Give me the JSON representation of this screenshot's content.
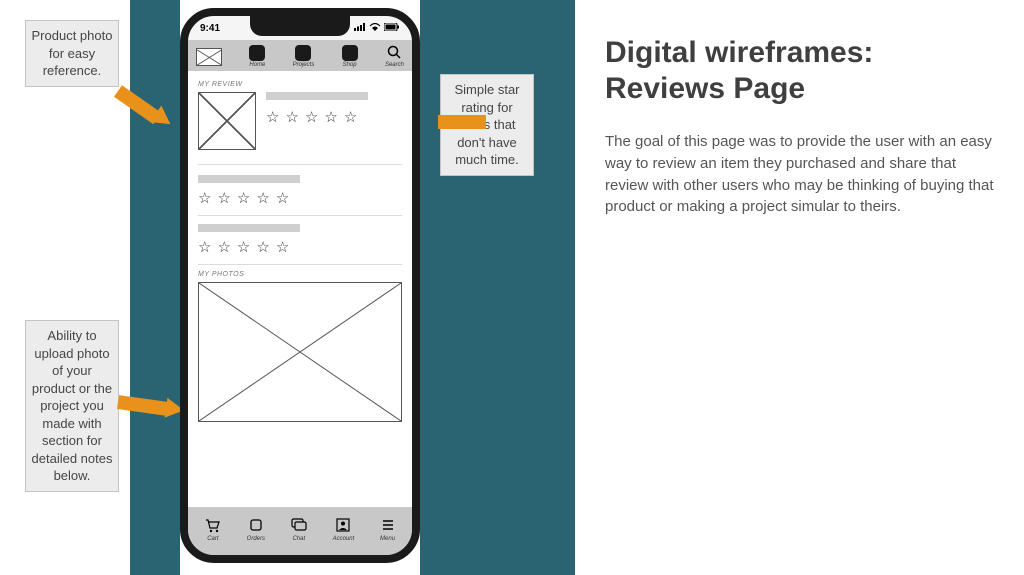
{
  "slide": {
    "heading": "Digital wireframes: Reviews Page",
    "paragraph": "The goal of this page was to provide the user with an easy way to review an item they purchased and share that review with other users who may be thinking of buying that product or making a project simular to theirs."
  },
  "callouts": {
    "product_photo": "Product photo for easy reference.",
    "star_rating": "Simple star rating for users that don't have much time.",
    "upload_photo": "Ability to upload photo of your product or the project you made with section for detailed notes below."
  },
  "phone": {
    "status": {
      "time": "9:41"
    },
    "topnav": {
      "home": "Home",
      "projects": "Projects",
      "shop": "Shop",
      "search": "Search"
    },
    "sections": {
      "my_review": "MY REVIEW",
      "my_photos": "MY PHOTOS"
    },
    "star_glyph": "☆",
    "bottomnav": {
      "cart": "Cart",
      "orders": "Orders",
      "chat": "Chat",
      "account": "Account",
      "menu": "Menu"
    }
  }
}
